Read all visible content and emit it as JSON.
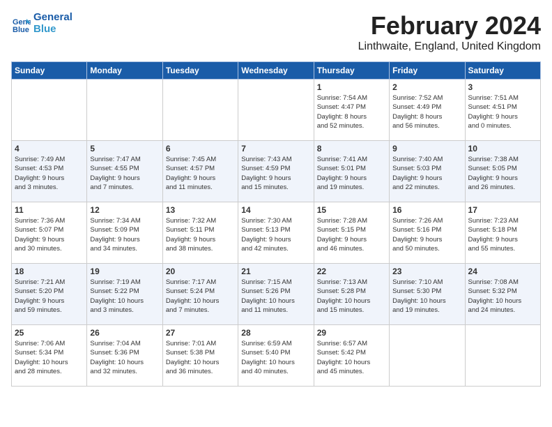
{
  "header": {
    "logo_line1": "General",
    "logo_line2": "Blue",
    "title": "February 2024",
    "subtitle": "Linthwaite, England, United Kingdom"
  },
  "columns": [
    "Sunday",
    "Monday",
    "Tuesday",
    "Wednesday",
    "Thursday",
    "Friday",
    "Saturday"
  ],
  "weeks": [
    [
      {
        "day": "",
        "content": ""
      },
      {
        "day": "",
        "content": ""
      },
      {
        "day": "",
        "content": ""
      },
      {
        "day": "",
        "content": ""
      },
      {
        "day": "1",
        "content": "Sunrise: 7:54 AM\nSunset: 4:47 PM\nDaylight: 8 hours\nand 52 minutes."
      },
      {
        "day": "2",
        "content": "Sunrise: 7:52 AM\nSunset: 4:49 PM\nDaylight: 8 hours\nand 56 minutes."
      },
      {
        "day": "3",
        "content": "Sunrise: 7:51 AM\nSunset: 4:51 PM\nDaylight: 9 hours\nand 0 minutes."
      }
    ],
    [
      {
        "day": "4",
        "content": "Sunrise: 7:49 AM\nSunset: 4:53 PM\nDaylight: 9 hours\nand 3 minutes."
      },
      {
        "day": "5",
        "content": "Sunrise: 7:47 AM\nSunset: 4:55 PM\nDaylight: 9 hours\nand 7 minutes."
      },
      {
        "day": "6",
        "content": "Sunrise: 7:45 AM\nSunset: 4:57 PM\nDaylight: 9 hours\nand 11 minutes."
      },
      {
        "day": "7",
        "content": "Sunrise: 7:43 AM\nSunset: 4:59 PM\nDaylight: 9 hours\nand 15 minutes."
      },
      {
        "day": "8",
        "content": "Sunrise: 7:41 AM\nSunset: 5:01 PM\nDaylight: 9 hours\nand 19 minutes."
      },
      {
        "day": "9",
        "content": "Sunrise: 7:40 AM\nSunset: 5:03 PM\nDaylight: 9 hours\nand 22 minutes."
      },
      {
        "day": "10",
        "content": "Sunrise: 7:38 AM\nSunset: 5:05 PM\nDaylight: 9 hours\nand 26 minutes."
      }
    ],
    [
      {
        "day": "11",
        "content": "Sunrise: 7:36 AM\nSunset: 5:07 PM\nDaylight: 9 hours\nand 30 minutes."
      },
      {
        "day": "12",
        "content": "Sunrise: 7:34 AM\nSunset: 5:09 PM\nDaylight: 9 hours\nand 34 minutes."
      },
      {
        "day": "13",
        "content": "Sunrise: 7:32 AM\nSunset: 5:11 PM\nDaylight: 9 hours\nand 38 minutes."
      },
      {
        "day": "14",
        "content": "Sunrise: 7:30 AM\nSunset: 5:13 PM\nDaylight: 9 hours\nand 42 minutes."
      },
      {
        "day": "15",
        "content": "Sunrise: 7:28 AM\nSunset: 5:15 PM\nDaylight: 9 hours\nand 46 minutes."
      },
      {
        "day": "16",
        "content": "Sunrise: 7:26 AM\nSunset: 5:16 PM\nDaylight: 9 hours\nand 50 minutes."
      },
      {
        "day": "17",
        "content": "Sunrise: 7:23 AM\nSunset: 5:18 PM\nDaylight: 9 hours\nand 55 minutes."
      }
    ],
    [
      {
        "day": "18",
        "content": "Sunrise: 7:21 AM\nSunset: 5:20 PM\nDaylight: 9 hours\nand 59 minutes."
      },
      {
        "day": "19",
        "content": "Sunrise: 7:19 AM\nSunset: 5:22 PM\nDaylight: 10 hours\nand 3 minutes."
      },
      {
        "day": "20",
        "content": "Sunrise: 7:17 AM\nSunset: 5:24 PM\nDaylight: 10 hours\nand 7 minutes."
      },
      {
        "day": "21",
        "content": "Sunrise: 7:15 AM\nSunset: 5:26 PM\nDaylight: 10 hours\nand 11 minutes."
      },
      {
        "day": "22",
        "content": "Sunrise: 7:13 AM\nSunset: 5:28 PM\nDaylight: 10 hours\nand 15 minutes."
      },
      {
        "day": "23",
        "content": "Sunrise: 7:10 AM\nSunset: 5:30 PM\nDaylight: 10 hours\nand 19 minutes."
      },
      {
        "day": "24",
        "content": "Sunrise: 7:08 AM\nSunset: 5:32 PM\nDaylight: 10 hours\nand 24 minutes."
      }
    ],
    [
      {
        "day": "25",
        "content": "Sunrise: 7:06 AM\nSunset: 5:34 PM\nDaylight: 10 hours\nand 28 minutes."
      },
      {
        "day": "26",
        "content": "Sunrise: 7:04 AM\nSunset: 5:36 PM\nDaylight: 10 hours\nand 32 minutes."
      },
      {
        "day": "27",
        "content": "Sunrise: 7:01 AM\nSunset: 5:38 PM\nDaylight: 10 hours\nand 36 minutes."
      },
      {
        "day": "28",
        "content": "Sunrise: 6:59 AM\nSunset: 5:40 PM\nDaylight: 10 hours\nand 40 minutes."
      },
      {
        "day": "29",
        "content": "Sunrise: 6:57 AM\nSunset: 5:42 PM\nDaylight: 10 hours\nand 45 minutes."
      },
      {
        "day": "",
        "content": ""
      },
      {
        "day": "",
        "content": ""
      }
    ]
  ]
}
